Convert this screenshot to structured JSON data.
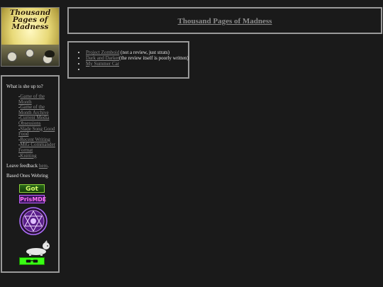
{
  "site": {
    "logo_text": "Thousand Pages of Madness",
    "title": "Thousand Pages of Madness"
  },
  "posts": [
    {
      "link": "Project Zomboid",
      "note": " (not a review, just strats)"
    },
    {
      "link": "Dark and Darker",
      "note": "(the review itself is poorly written)"
    },
    {
      "link": "My Summer Car",
      "note": ""
    },
    {
      "link": "",
      "note": ""
    }
  ],
  "sidebar": {
    "heading": "What is she up to?",
    "nav": [
      {
        "prefix": "-",
        "label": "Game of the Month"
      },
      {
        "prefix": "-",
        "label": "Game of the Month Archive"
      },
      {
        "prefix": "-",
        "label": "Current Media Obsessions"
      },
      {
        "prefix": "-",
        "label": "Slade Song Good Food"
      },
      {
        "prefix": "-",
        "label": "Recent Writing"
      },
      {
        "prefix": "-",
        "label": "MtG Commander Format"
      },
      {
        "prefix": "-",
        "label": "Knitting"
      }
    ],
    "feedback_prefix": "Leave feedback ",
    "feedback_link": "here",
    "feedback_suffix": ".",
    "webring_label": "Based Ones Webring"
  },
  "badges": {
    "got": "Got",
    "prism": "PrisMDE"
  }
}
